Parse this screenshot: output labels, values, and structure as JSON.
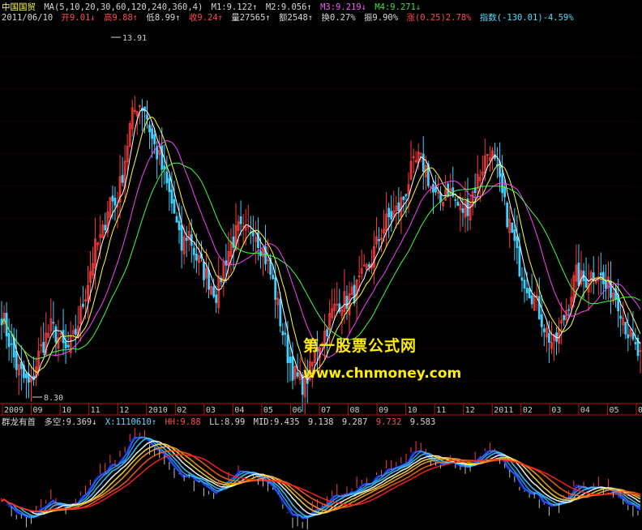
{
  "header": {
    "stock_name": "中国国贸",
    "ma_params": "MA(5,10,20,30,60,120,240,360,4)",
    "m1": "M1:9.122↑",
    "m2": "M2:9.056↑",
    "m3": "M3:9.219↓",
    "m4": "M4:9.271↓",
    "date": "2011/06/10",
    "open": "开9.01↓",
    "high": "高9.88↑",
    "low": "低8.99↑",
    "close": "收9.24↑",
    "volume": "量27565↑",
    "amount": "额2548↑",
    "turnover": "换0.27%",
    "amplitude": "振9.90%",
    "change": "涨(0.25)2.78%",
    "index": "指数(-130.01)-4.59%"
  },
  "sub_header": {
    "indicator_name": "群龙有首",
    "duokong": "多空:9.369↓",
    "x": "X:1110610↑",
    "hh": "HH:9.88",
    "ll": "LL:8.99",
    "mid": "MID:9.435",
    "v1": "9.138",
    "v2": "9.287",
    "v3": "9.732",
    "v4": "9.583"
  },
  "watermark": {
    "line1": "第一股票公式网",
    "line2": "www.chnmoney.com"
  },
  "colors": {
    "background": "#000000",
    "up_candle": "#ff3b3b",
    "down_candle": "#3fd0ff",
    "ma5": "#ffffff",
    "ma10": "#ffff40",
    "ma20": "#ff40ff",
    "ma30": "#40ff40",
    "axis": "#c01010",
    "watermark": "#ffee00"
  },
  "chart_data": [
    {
      "type": "candlestick",
      "title": "中国国贸",
      "y_range": [
        8.3,
        13.91
      ],
      "annotations": [
        {
          "label": "13.91",
          "value": 13.91,
          "date": "2009-12"
        },
        {
          "label": "8.30",
          "value": 8.3,
          "date": "2009-09"
        }
      ],
      "x_ticks": [
        "2009",
        "09",
        "10",
        "11",
        "12",
        "2010",
        "02",
        "03",
        "04",
        "05",
        "06",
        "07",
        "08",
        "09",
        "10",
        "11",
        "12",
        "2011",
        "02",
        "03",
        "04",
        "05",
        "0"
      ],
      "close_path": [
        9.6,
        9.2,
        8.8,
        8.6,
        8.45,
        8.9,
        9.2,
        9.4,
        9.2,
        9.0,
        9.2,
        9.6,
        10.1,
        10.6,
        10.8,
        11.4,
        11.3,
        11.9,
        12.6,
        12.9,
        12.8,
        12.3,
        12.0,
        11.6,
        11.2,
        10.6,
        10.9,
        10.5,
        10.3,
        10.1,
        9.9,
        10.4,
        10.7,
        10.9,
        10.8,
        11.0,
        10.7,
        10.4,
        10.0,
        9.4,
        8.9,
        8.6,
        8.5,
        8.7,
        9.1,
        9.3,
        9.6,
        9.8,
        9.8,
        9.9,
        10.1,
        10.3,
        10.6,
        10.9,
        11.1,
        11.2,
        11.4,
        11.8,
        12.0,
        11.9,
        11.5,
        11.3,
        11.6,
        11.4,
        11.2,
        11.3,
        11.6,
        11.9,
        12.2,
        11.8,
        11.3,
        10.9,
        10.4,
        10.1,
        9.9,
        9.6,
        9.3,
        9.1,
        9.4,
        9.8,
        10.2,
        10.1,
        10.2,
        10.3,
        10.0,
        10.0,
        9.8,
        9.4,
        9.1,
        8.9
      ]
    },
    {
      "type": "area",
      "title": "群龙有首",
      "series": [
        {
          "name": "多空",
          "last": 9.369
        },
        {
          "name": "HH",
          "last": 9.88
        },
        {
          "name": "LL",
          "last": 8.99
        },
        {
          "name": "MID",
          "last": 9.435
        }
      ]
    }
  ]
}
